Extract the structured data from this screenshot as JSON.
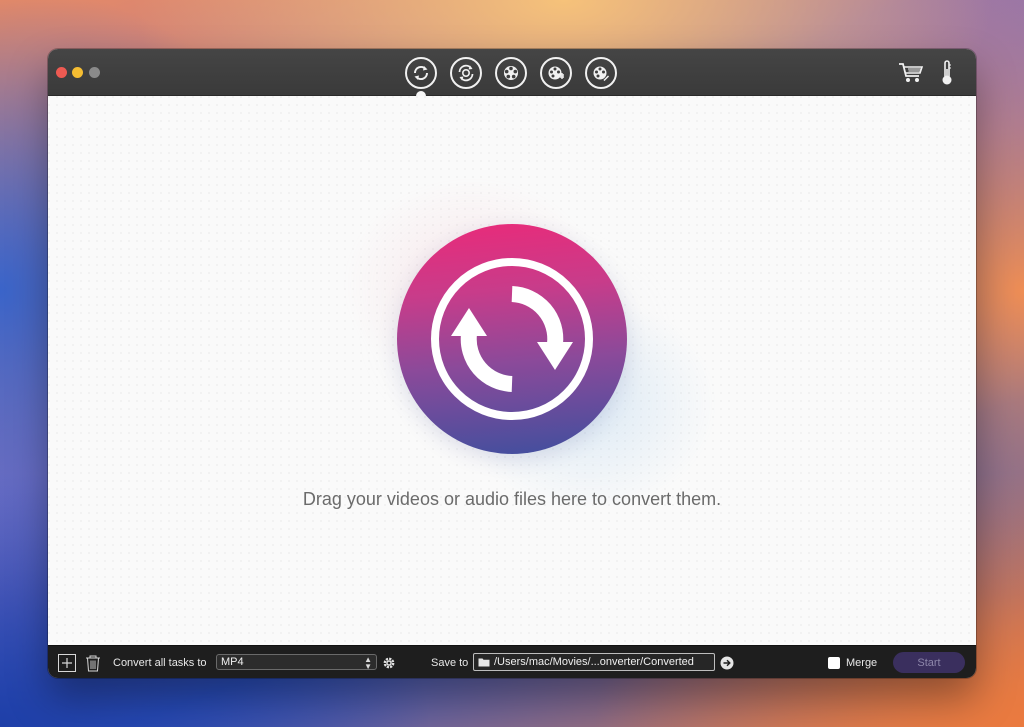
{
  "window": {
    "toolbar": {
      "tools": [
        {
          "icon": "convert-icon",
          "active": true
        },
        {
          "icon": "rotate-reel-icon",
          "active": false
        },
        {
          "icon": "film-reel-icon",
          "active": false
        },
        {
          "icon": "film-reel-edit-icon",
          "active": false
        },
        {
          "icon": "film-reel-pen-icon",
          "active": false
        }
      ],
      "right_icons": [
        "cart-icon",
        "thermometer-icon"
      ]
    }
  },
  "main": {
    "drop_hint": "Drag your videos or audio files here to convert them.",
    "hero_icon": "convert-arrows-icon"
  },
  "bottombar": {
    "convert_all_label": "Convert all tasks to",
    "format_value": "MP4",
    "save_to_label": "Save to",
    "save_path": "/Users/mac/Movies/...onverter/Converted",
    "merge_label": "Merge",
    "merge_checked": false,
    "start_label": "Start"
  },
  "colors": {
    "titlebar": "#3f3f3f",
    "hero_top": "#ea2a79",
    "hero_bottom": "#3f4f9e",
    "start_button": "#3a2f5e"
  }
}
